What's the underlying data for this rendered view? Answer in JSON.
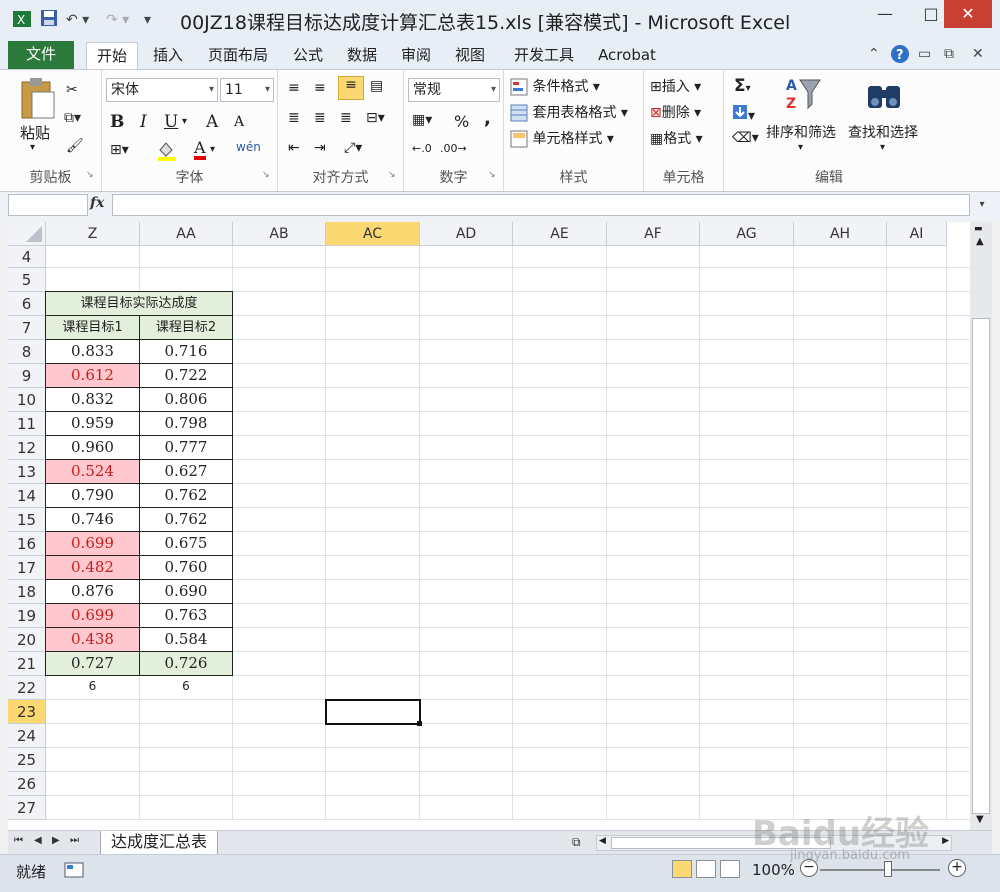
{
  "window": {
    "title": "00JZ18课程目标达成度计算汇总表15.xls  [兼容模式] - Microsoft Excel",
    "min_glyph": "—",
    "max_glyph": "□",
    "close_glyph": "✕"
  },
  "tabs": [
    "文件",
    "开始",
    "插入",
    "页面布局",
    "公式",
    "数据",
    "审阅",
    "视图",
    "开发工具",
    "Acrobat"
  ],
  "ribbon": {
    "clipboard": {
      "label": "剪贴板",
      "paste": "粘贴"
    },
    "font": {
      "label": "字体",
      "font_name": "宋体",
      "font_size": "11",
      "bold": "B",
      "italic": "I",
      "underline": "U",
      "grow": "A",
      "shrink": "A",
      "wen": "wén"
    },
    "alignment": {
      "label": "对齐方式"
    },
    "number": {
      "label": "数字",
      "format": "常规",
      "percent": "%",
      "comma": ","
    },
    "styles": {
      "label": "样式",
      "conditional": "条件格式",
      "table_format": "套用表格格式",
      "cell_styles": "单元格样式"
    },
    "cells": {
      "label": "单元格",
      "insert": "插入",
      "delete": "删除",
      "format": "格式"
    },
    "editing": {
      "label": "编辑",
      "sum": "Σ",
      "sort_filter": "排序和筛选",
      "find_select": "查找和选择"
    }
  },
  "formula_bar": {
    "fx": "fx",
    "name_box": "",
    "value": ""
  },
  "columns": [
    "Z",
    "AA",
    "AB",
    "AC",
    "AD",
    "AE",
    "AF",
    "AG",
    "AH",
    "AI"
  ],
  "selected_column": "AC",
  "rows": [
    "4",
    "5",
    "6",
    "7",
    "8",
    "9",
    "10",
    "11",
    "12",
    "13",
    "14",
    "15",
    "16",
    "17",
    "18",
    "19",
    "20",
    "21",
    "22",
    "23",
    "24",
    "25",
    "26",
    "27"
  ],
  "selected_row": "23",
  "table": {
    "merged_header": "课程目标实际达成度",
    "col_headers": [
      "课程目标1",
      "课程目标2"
    ],
    "values": [
      [
        "0.833",
        "0.716"
      ],
      [
        "0.612",
        "0.722"
      ],
      [
        "0.832",
        "0.806"
      ],
      [
        "0.959",
        "0.798"
      ],
      [
        "0.960",
        "0.777"
      ],
      [
        "0.524",
        "0.627"
      ],
      [
        "0.790",
        "0.762"
      ],
      [
        "0.746",
        "0.762"
      ],
      [
        "0.699",
        "0.675"
      ],
      [
        "0.482",
        "0.760"
      ],
      [
        "0.876",
        "0.690"
      ],
      [
        "0.699",
        "0.763"
      ],
      [
        "0.438",
        "0.584"
      ]
    ],
    "highlight_rows_col1": [
      1,
      5,
      8,
      9,
      11,
      12
    ],
    "averages": [
      "0.727",
      "0.726"
    ],
    "counts": [
      "6",
      "6"
    ]
  },
  "sheet_tabs": [
    "达成度汇总表"
  ],
  "status": {
    "ready": "就绪",
    "zoom": "100%"
  },
  "watermark": {
    "brand": "Baidu经验",
    "url": "jingyan.baidu.com"
  },
  "colors": {
    "green_fill": "#e2efda",
    "pink_fill": "#ffc7ce",
    "pink_text": "#c0201e",
    "selected_header": "#fbd872",
    "file_tab": "#2b7a3b"
  }
}
